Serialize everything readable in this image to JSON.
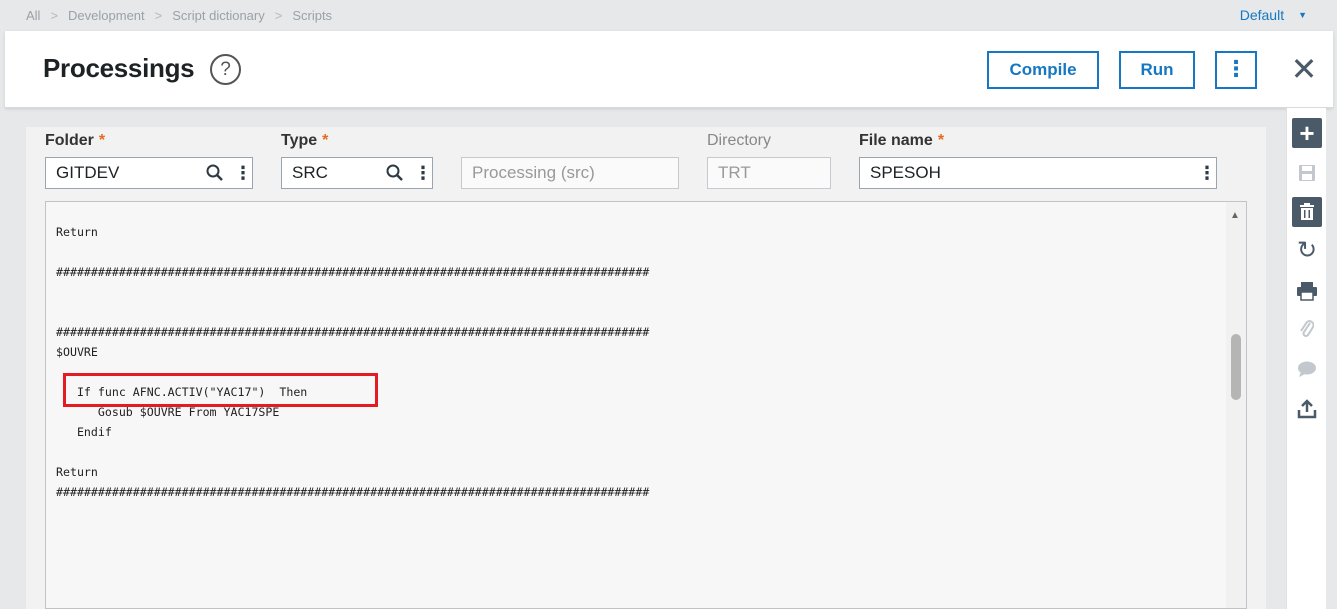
{
  "breadcrumb": {
    "items": [
      "All",
      "Development",
      "Script dictionary",
      "Scripts"
    ]
  },
  "profile": {
    "label": "Default"
  },
  "header": {
    "title": "Processings",
    "help": "?"
  },
  "actions": {
    "compile": "Compile",
    "run": "Run",
    "more": "⋮",
    "close": "✕"
  },
  "form": {
    "folder": {
      "label": "Folder",
      "value": "GITDEV",
      "required": "*"
    },
    "type": {
      "label": "Type",
      "value": "SRC",
      "required": "*"
    },
    "type_desc": {
      "value": "Processing (src)"
    },
    "directory": {
      "label": "Directory",
      "value": "TRT"
    },
    "filename": {
      "label": "File name",
      "value": "SPESOH",
      "required": "*"
    }
  },
  "editor": {
    "code": "Return\n\n#####################################################################################\n\n\n#####################################################################################\n$OUVRE\n\n   If func AFNC.ACTIV(\"YAC17\")  Then\n      Gosub $OUVRE From YAC17SPE\n   Endif\n\nReturn\n#####################################################################################"
  },
  "toolbar": {
    "add": "add-icon",
    "save": "save-icon",
    "delete": "trash-icon",
    "refresh": "refresh-icon",
    "print": "print-icon",
    "attach": "paperclip-icon",
    "comment": "comment-icon",
    "export": "export-icon"
  },
  "colors": {
    "accent": "#1678c2",
    "required": "#e86a1e",
    "highlight": "#e31c23",
    "toolbar_dark": "#4a5a68"
  }
}
